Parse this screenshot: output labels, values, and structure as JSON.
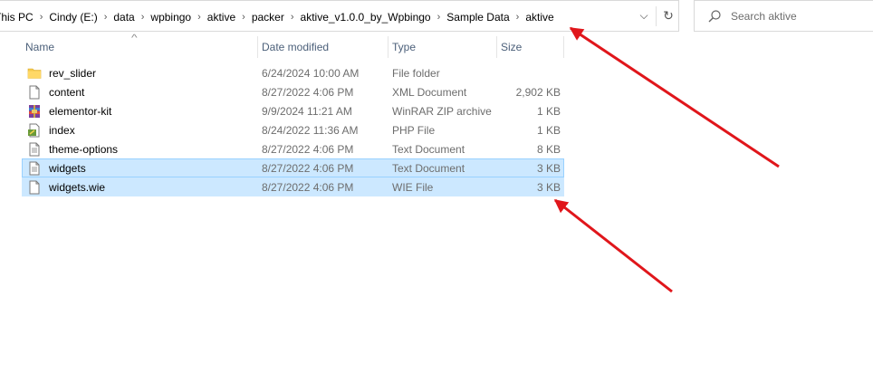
{
  "address_bar": {
    "breadcrumbs": [
      "This PC",
      "Cindy (E:)",
      "data",
      "wpbingo",
      "aktive",
      "packer",
      "aktive_v1.0.0_by_Wpbingo",
      "Sample Data",
      "aktive"
    ],
    "separator": "›",
    "dropdown_glyph": "⌵",
    "refresh_glyph": "↻"
  },
  "search": {
    "placeholder": "Search aktive",
    "icon": "search-icon"
  },
  "columns": {
    "name": "Name",
    "date": "Date modified",
    "type": "Type",
    "size": "Size",
    "sort_glyph": "^"
  },
  "files": [
    {
      "name": "rev_slider",
      "date": "6/24/2024 10:00 AM",
      "type": "File folder",
      "size": "",
      "icon": "folder-icon",
      "selected": false
    },
    {
      "name": "content",
      "date": "8/27/2022 4:06 PM",
      "type": "XML Document",
      "size": "2,902 KB",
      "icon": "document-icon",
      "selected": false
    },
    {
      "name": "elementor-kit",
      "date": "9/9/2024 11:21 AM",
      "type": "WinRAR ZIP archive",
      "size": "1 KB",
      "icon": "winrar-archive-icon",
      "selected": false
    },
    {
      "name": "index",
      "date": "8/24/2022 11:36 AM",
      "type": "PHP File",
      "size": "1 KB",
      "icon": "php-file-icon",
      "selected": false
    },
    {
      "name": "theme-options",
      "date": "8/27/2022 4:06 PM",
      "type": "Text Document",
      "size": "8 KB",
      "icon": "text-document-icon",
      "selected": false
    },
    {
      "name": "widgets",
      "date": "8/27/2022 4:06 PM",
      "type": "Text Document",
      "size": "3 KB",
      "icon": "text-document-icon",
      "selected": true
    },
    {
      "name": "widgets.wie",
      "date": "8/27/2022 4:06 PM",
      "type": "WIE File",
      "size": "3 KB",
      "icon": "blank-file-icon",
      "selected": true
    }
  ],
  "colors": {
    "selection": "#cce8ff",
    "annotation_arrow": "#e0161b",
    "header_text": "#4c607a"
  }
}
